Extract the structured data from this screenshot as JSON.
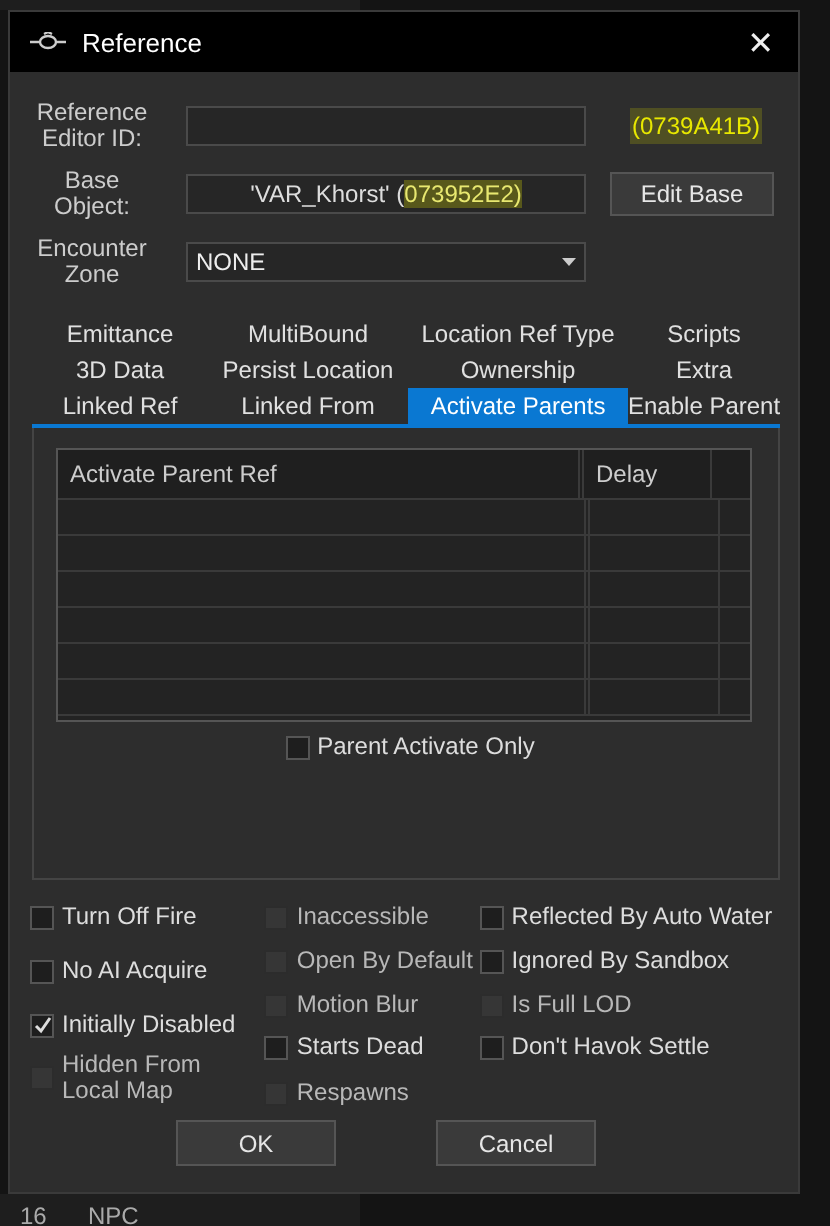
{
  "background_list": {
    "bottom_row": [
      "16",
      "NPC"
    ]
  },
  "window": {
    "title": "Reference",
    "close": "✕"
  },
  "editor_id": {
    "label": "Reference Editor ID:",
    "form_id": "(0739A41B)"
  },
  "base_object": {
    "label": "Base Object:",
    "value": "'VAR_Khorst' (",
    "highlighted": "073952E2)",
    "button": "Edit Base"
  },
  "encounter_zone": {
    "label": "Encounter Zone",
    "value": "NONE"
  },
  "tab_rows": [
    [
      {
        "label": "Emittance",
        "selected": false
      },
      {
        "label": "MultiBound",
        "selected": false
      },
      {
        "label": "Location Ref Type",
        "selected": false
      },
      {
        "label": "Scripts",
        "selected": false
      }
    ],
    [
      {
        "label": "3D Data",
        "selected": false
      },
      {
        "label": "Persist Location",
        "selected": false
      },
      {
        "label": "Ownership",
        "selected": false
      },
      {
        "label": "Extra",
        "selected": false
      }
    ],
    [
      {
        "label": "Linked Ref",
        "selected": false
      },
      {
        "label": "Linked From",
        "selected": false
      },
      {
        "label": "Activate Parents",
        "selected": true
      },
      {
        "label": "Enable Parent",
        "selected": false
      }
    ]
  ],
  "table": {
    "columns": [
      "Activate Parent Ref",
      "Delay"
    ]
  },
  "parent_activate_only": {
    "label": "Parent Activate Only",
    "checked": false
  },
  "flag_columns": [
    [
      {
        "label": "Turn Off Fire",
        "checked": false,
        "disabled": false
      },
      {
        "label": "No AI Acquire",
        "checked": false,
        "disabled": false
      },
      {
        "label": "Initially Disabled",
        "checked": true,
        "disabled": false
      },
      {
        "label": "Hidden From Local Map",
        "checked": false,
        "disabled": true
      }
    ],
    [
      {
        "label": "Inaccessible",
        "checked": false,
        "disabled": true
      },
      {
        "label": "Open By Default",
        "checked": false,
        "disabled": true
      },
      {
        "label": "Motion Blur",
        "checked": false,
        "disabled": true
      },
      {
        "label": "Starts Dead",
        "checked": false,
        "disabled": false
      },
      {
        "label": "Respawns",
        "checked": false,
        "disabled": true
      }
    ],
    [
      {
        "label": "Reflected By Auto Water",
        "checked": false,
        "disabled": false
      },
      {
        "label": "Ignored By Sandbox",
        "checked": false,
        "disabled": false
      },
      {
        "label": "Is Full LOD",
        "checked": false,
        "disabled": true
      },
      {
        "label": "Don't Havok Settle",
        "checked": false,
        "disabled": false
      }
    ]
  ],
  "buttons": [
    "OK",
    "Cancel"
  ]
}
